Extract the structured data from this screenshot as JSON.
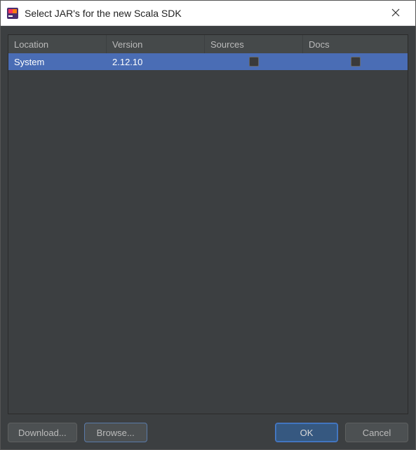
{
  "titlebar": {
    "title": "Select JAR's for the new Scala SDK",
    "icon": "intellij-icon"
  },
  "table": {
    "headers": {
      "location": "Location",
      "version": "Version",
      "sources": "Sources",
      "docs": "Docs"
    },
    "rows": [
      {
        "location": "System",
        "version": "2.12.10",
        "sources_checked": false,
        "docs_checked": false,
        "selected": true
      }
    ]
  },
  "buttons": {
    "download": "Download...",
    "browse": "Browse...",
    "ok": "OK",
    "cancel": "Cancel"
  },
  "colors": {
    "panel_bg": "#3c3f41",
    "selection": "#4a6db5",
    "header_bg": "#45494a"
  }
}
